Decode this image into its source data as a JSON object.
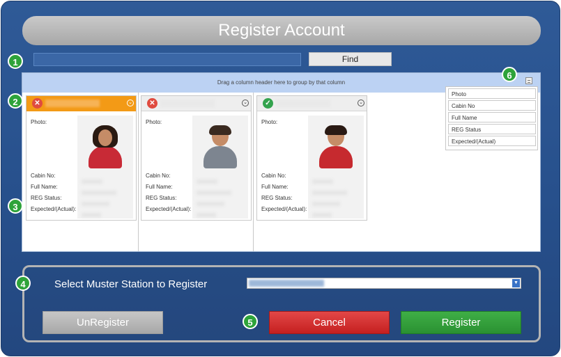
{
  "window": {
    "title": "Register Account"
  },
  "callouts": [
    "1",
    "2",
    "3",
    "4",
    "5",
    "6"
  ],
  "search": {
    "value": "",
    "find_label": "Find"
  },
  "grid": {
    "group_hint": "Drag a column header here to group by that column",
    "field_labels": {
      "photo": "Photo:",
      "cabin": "Cabin No:",
      "full_name": "Full Name:",
      "reg_status": "REG Status:",
      "expected": "Expected/(Actual):"
    },
    "cards": [
      {
        "status_icon": "x-circle-icon",
        "selected": true
      },
      {
        "status_icon": "x-circle-icon",
        "selected": false
      },
      {
        "status_icon": "check-circle-icon",
        "selected": false
      }
    ],
    "column_chooser": [
      "Photo",
      "Cabin No",
      "Full Name",
      "REG Status",
      "Expected/(Actual)"
    ]
  },
  "muster": {
    "label": "Select Muster Station to Register"
  },
  "buttons": {
    "unregister": "UnRegister",
    "cancel": "Cancel",
    "register": "Register"
  },
  "colors": {
    "background": "#2f5a97",
    "selected_header": "#f39a16",
    "cancel": "#d03030",
    "register": "#35a03d",
    "callout": "#2ea33a"
  }
}
